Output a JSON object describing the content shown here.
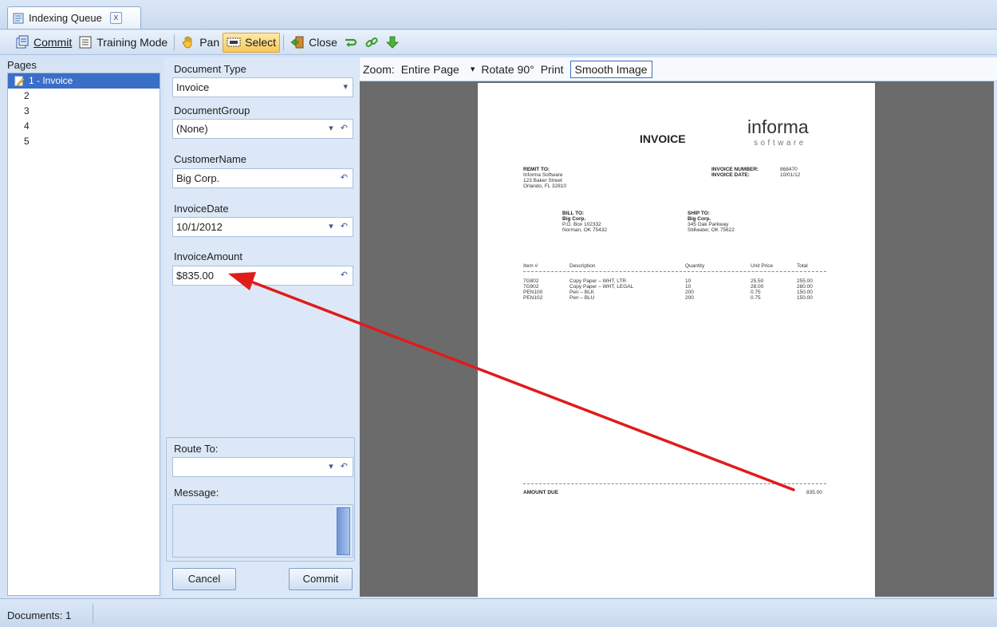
{
  "tab": {
    "label": "Indexing Queue",
    "close": "x"
  },
  "toolbar": {
    "commit": "Commit",
    "training_mode": "Training Mode",
    "pan": "Pan",
    "select": "Select",
    "close": "Close"
  },
  "pages": {
    "label": "Pages",
    "items": [
      "1 - Invoice",
      "2",
      "3",
      "4",
      "5"
    ]
  },
  "fields": {
    "document_type": {
      "label": "Document Type",
      "value": "Invoice"
    },
    "document_group": {
      "label": "DocumentGroup",
      "value": "(None)"
    },
    "customer_name": {
      "label": "CustomerName",
      "value": "Big Corp."
    },
    "invoice_date": {
      "label": "InvoiceDate",
      "value": "10/1/2012"
    },
    "invoice_amount": {
      "label": "InvoiceAmount",
      "value": "$835.00"
    },
    "route_to": {
      "label": "Route To:",
      "value": ""
    },
    "message": {
      "label": "Message:",
      "value": ""
    },
    "cancel": "Cancel",
    "commit": "Commit"
  },
  "viewer": {
    "zoom_label": "Zoom:",
    "zoom_value": "Entire Page",
    "rotate": "Rotate 90°",
    "print": "Print",
    "smooth": "Smooth Image"
  },
  "invoice": {
    "title": "INVOICE",
    "logo_top": "informa",
    "logo_bottom": "software",
    "remit_label": "REMIT TO:",
    "remit_lines": [
      "Informa Software",
      "123 Baker Street",
      "Orlando, FL 32810"
    ],
    "invoice_number_label": "INVOICE NUMBER:",
    "invoice_number": "868470",
    "invoice_date_label": "INVOICE DATE:",
    "invoice_date": "10/01/12",
    "bill_label": "BILL TO:",
    "bill_lines": [
      "Big Corp.",
      "P.O. Box 102332",
      "Norman, OK 75432"
    ],
    "ship_label": "SHIP TO:",
    "ship_lines": [
      "Big Corp.",
      "345 Oak Parkway",
      "Stillwater, OK 75622"
    ],
    "headers": [
      "Item #",
      "Description",
      "Quantity",
      "Unit Price",
      "Total"
    ],
    "rows": [
      [
        "7G802",
        "Copy Paper – WHT, LTR",
        "10",
        "25.50",
        "255.00"
      ],
      [
        "7G902",
        "Copy Paper – WHT, LEGAL",
        "10",
        "28.00",
        "280.00"
      ],
      [
        "PEN100",
        "Pen – BLK",
        "200",
        "0.75",
        "150.00"
      ],
      [
        "PEN102",
        "Pen – BLU",
        "200",
        "0.75",
        "150.00"
      ]
    ],
    "amount_due_label": "AMOUNT DUE",
    "amount_due": "835.00"
  },
  "status": {
    "documents": "Documents: 1"
  },
  "colors": {
    "accent": "#3a6ec7",
    "arrow": "#e01b1b",
    "viewer_bg": "#6b6b6b"
  }
}
